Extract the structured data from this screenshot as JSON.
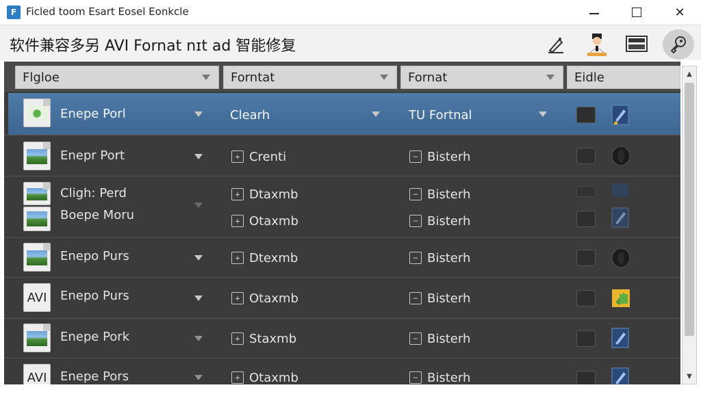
{
  "window": {
    "title": "Ficled toom Esart Eosel Eonkcle",
    "icon_label": "F"
  },
  "toolbar": {
    "heading": "软件兼容多另 AVI Fornat nɪt ad 智能修复",
    "tools": [
      "pen-icon",
      "user-icon",
      "monitor-icon",
      "settings-icon"
    ]
  },
  "grid": {
    "columns": [
      "Flgloe",
      "Forntat",
      "Fornat",
      "Eidle"
    ],
    "rows": [
      {
        "name": "Enepe Porl",
        "format": "Clearh",
        "target": "TU Fortnal",
        "icon": "image",
        "selected": true,
        "action": "blue-pen"
      },
      {
        "name": "Enepr Port",
        "format": "Crenti",
        "target": "Bisterh",
        "icon": "image",
        "action": "disc"
      },
      {
        "name": "Cligh: Perd",
        "format": "Dtaxmb",
        "target": "Bisterh",
        "icon": "image",
        "faded": true,
        "action": "blue-dim"
      },
      {
        "name": "Boepe Moru",
        "format": "Otaxmb",
        "target": "Bisterh",
        "icon": "image",
        "action": "blue-dim"
      },
      {
        "name": "Enepo Purs",
        "format": "Dtexmb",
        "target": "Bisterh",
        "icon": "image",
        "action": "disc"
      },
      {
        "name": "Enepo Purs",
        "format": "Otaxmb",
        "target": "Bisterh",
        "icon": "avi",
        "icon_text": "AVI",
        "action": "green"
      },
      {
        "name": "Enepe Pork",
        "format": "Staxmb",
        "target": "Bisterh",
        "icon": "image",
        "action": "blue-pen"
      },
      {
        "name": "Enepe Pors",
        "format": "Otaxmb",
        "target": "Bisterh",
        "icon": "avi",
        "icon_text": "AVI",
        "action": "blue-pen"
      }
    ]
  },
  "colors": {
    "grid_bg": "#3b3b3b",
    "selected_row": "#4670a0",
    "header_bg": "#d6d6d6"
  }
}
